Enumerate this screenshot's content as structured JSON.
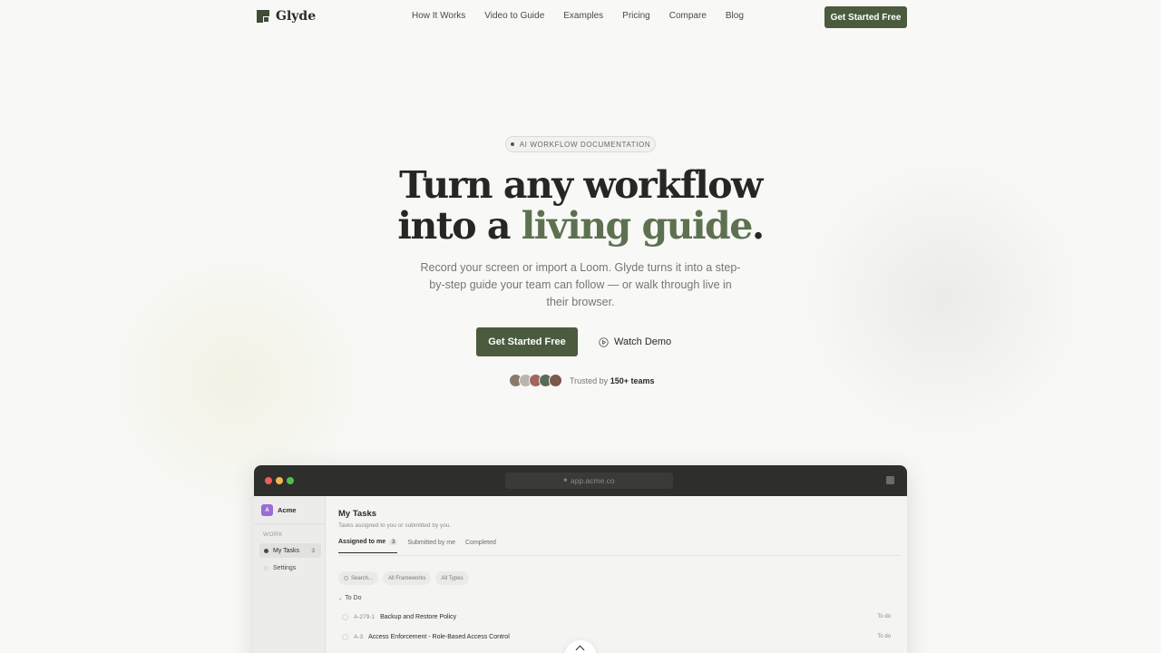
{
  "brand": {
    "name": "Glyde",
    "accent": "#4a5b3e"
  },
  "nav": {
    "links": [
      "How It Works",
      "Video to Guide",
      "Examples",
      "Pricing",
      "Compare",
      "Blog"
    ],
    "cta": "Get Started Free"
  },
  "hero": {
    "pill": "AI WORKFLOW DOCUMENTATION",
    "headline_line1": "Turn any workflow",
    "headline_pre": "into a ",
    "headline_accent": "living guide",
    "headline_post": ".",
    "subtitle": "Record your screen or import a Loom. Glyde turns it into a step-by-step guide your team can follow — or walk through live in their browser.",
    "primary_cta": "Get Started Free",
    "secondary_cta": "Watch Demo",
    "trust_prefix": "Trusted by ",
    "trust_count": "150+ teams",
    "avatar_colors": [
      "#8a7a6a",
      "#b8b4ae",
      "#a0685a",
      "#5a6a5a",
      "#7a5a4a"
    ]
  },
  "app": {
    "url": "app.acme.co",
    "workspace": {
      "initial": "A",
      "name": "Acme"
    },
    "sidebar": {
      "section": "WORK",
      "items": [
        {
          "label": "My Tasks",
          "count": "3"
        },
        {
          "label": "Settings"
        }
      ]
    },
    "main": {
      "title": "My Tasks",
      "subtitle": "Tasks assigned to you or submitted by you.",
      "tabs": [
        {
          "label": "Assigned to me",
          "count": "3"
        },
        {
          "label": "Submitted by me"
        },
        {
          "label": "Completed"
        }
      ],
      "filters": [
        "Search...",
        "All Frameworks",
        "All Types"
      ],
      "group": "To Do",
      "rows": [
        {
          "id": "A-279-1",
          "title": "Backup and Restore Policy",
          "status": "To do"
        },
        {
          "id": "A-3",
          "title": "Access Enforcement - Role-Based Access Control",
          "status": "To do"
        }
      ]
    }
  }
}
